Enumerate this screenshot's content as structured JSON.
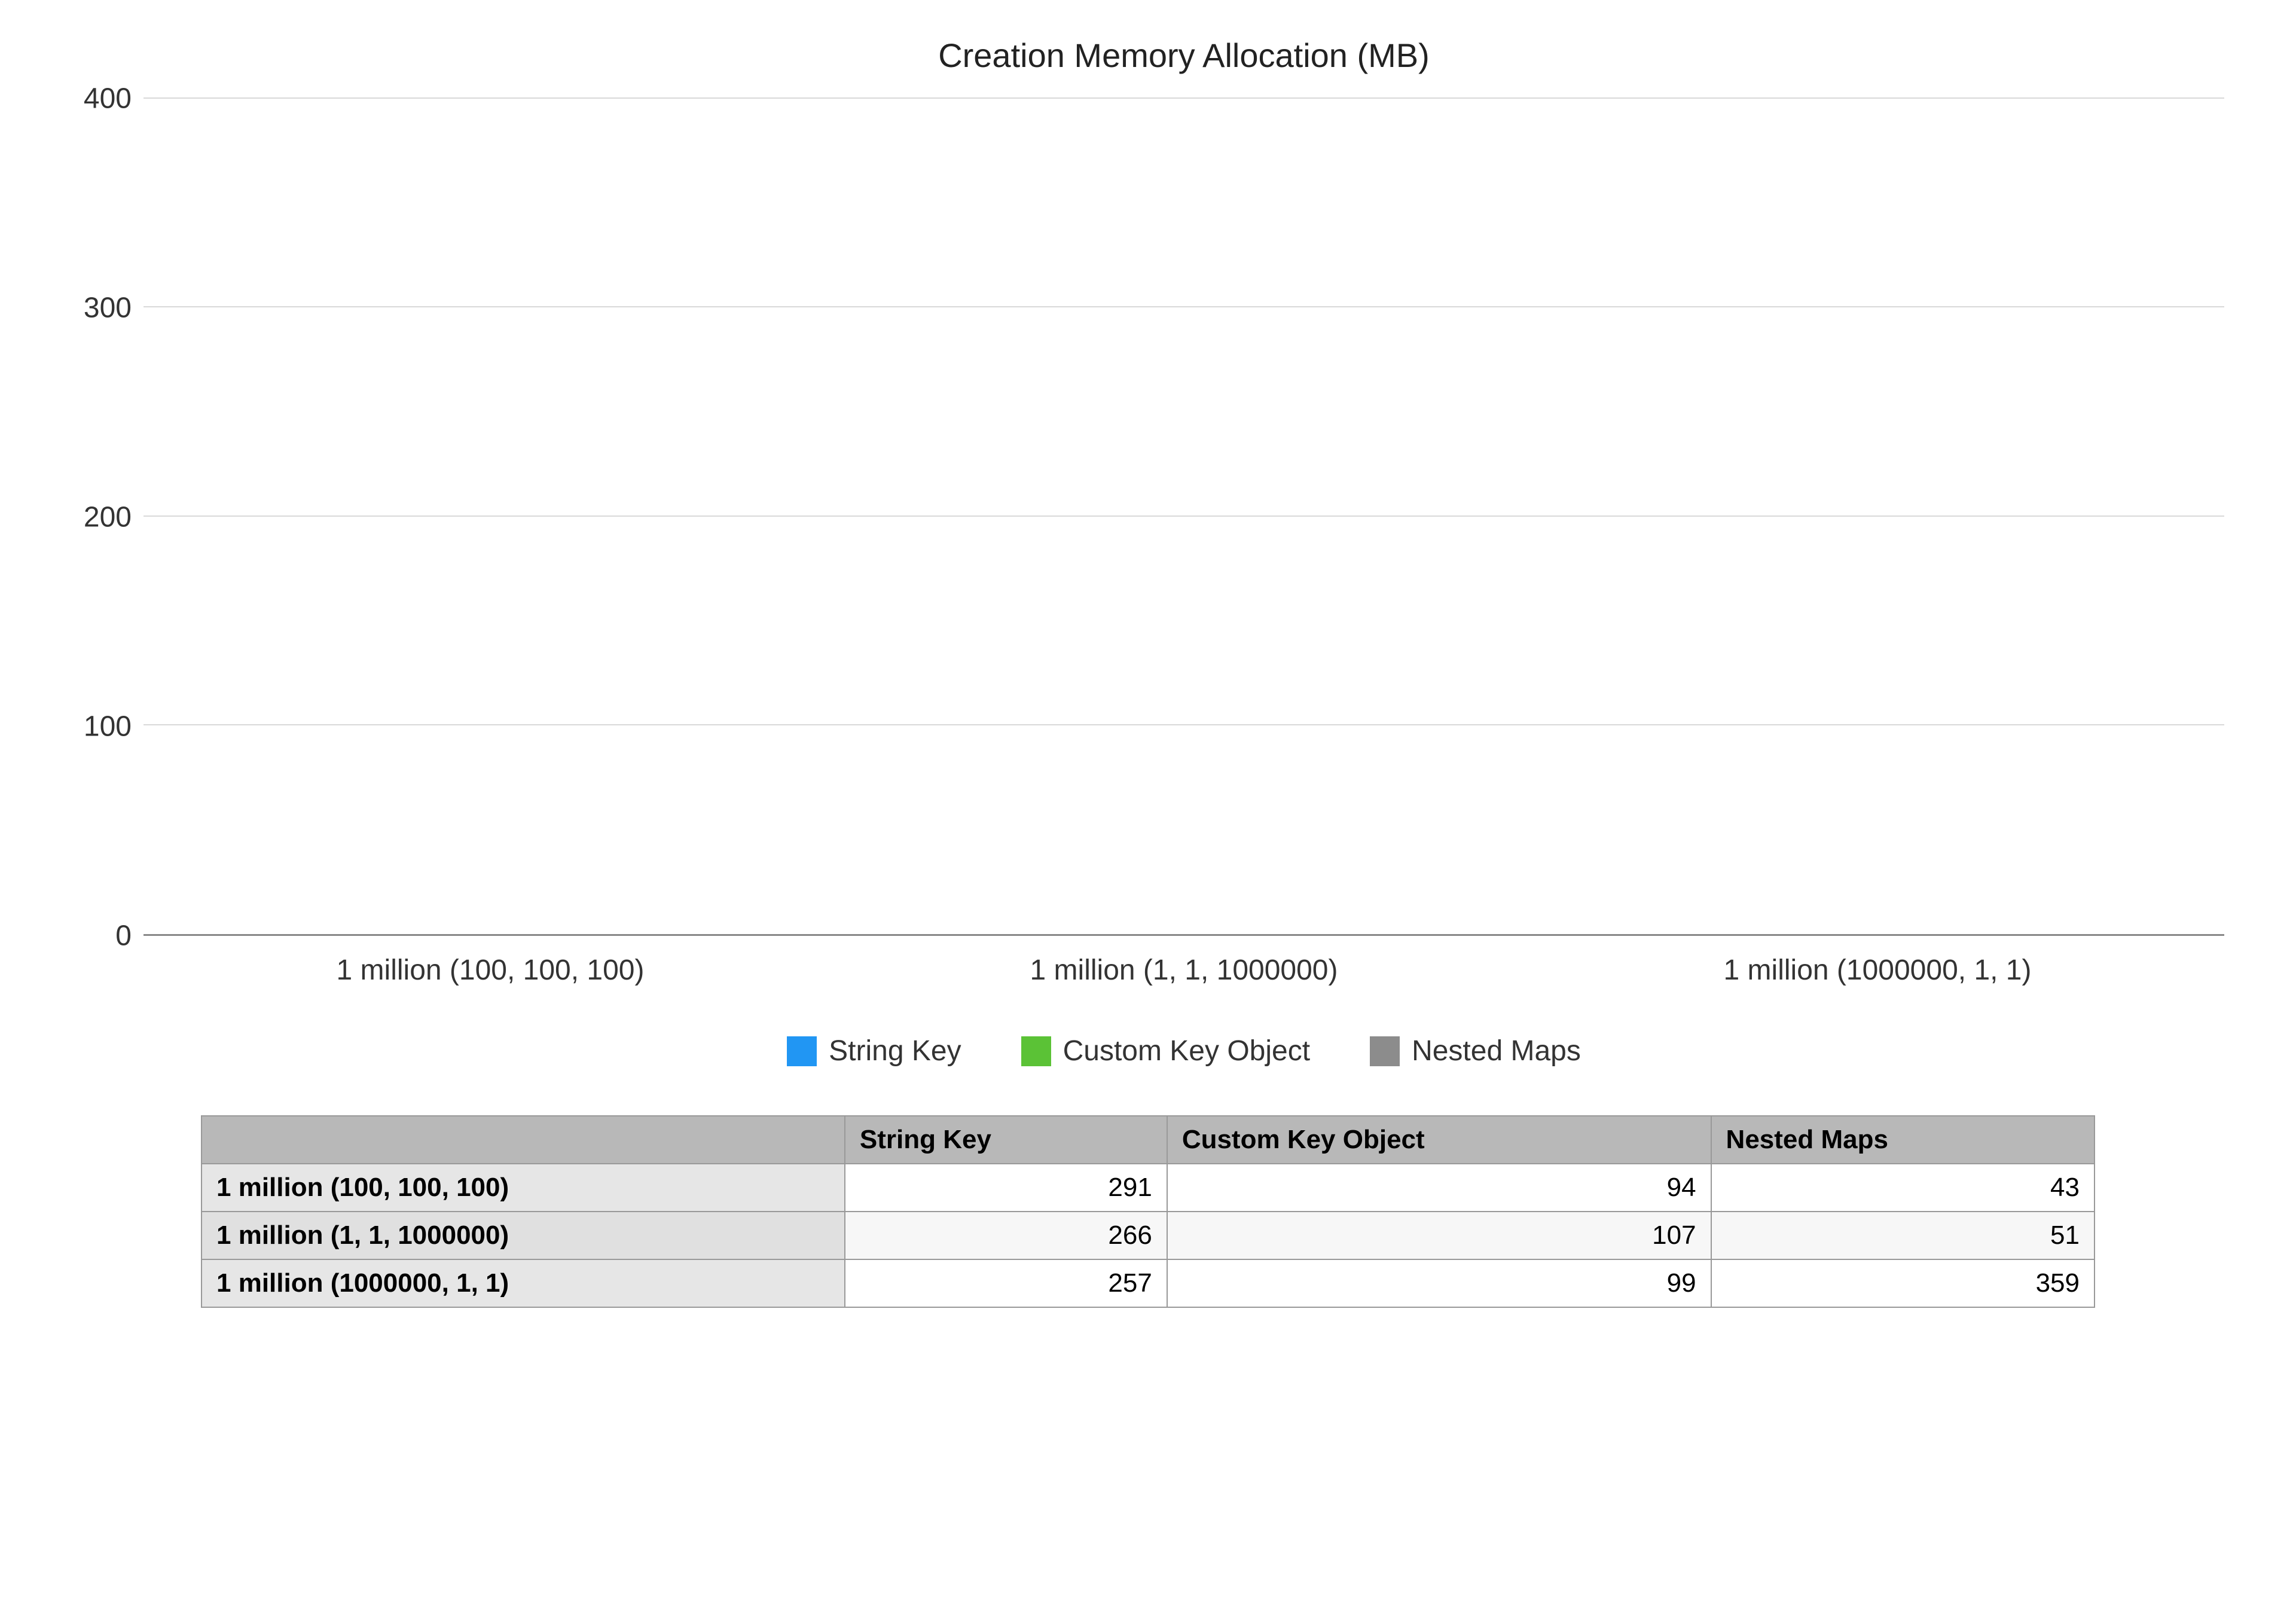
{
  "chart_data": {
    "type": "bar",
    "title": "Creation Memory Allocation (MB)",
    "xlabel": "",
    "ylabel": "",
    "ylim": [
      0,
      400
    ],
    "yticks": [
      0,
      100,
      200,
      300,
      400
    ],
    "categories": [
      "1 million (100, 100, 100)",
      "1 million (1, 1, 1000000)",
      "1 million (1000000, 1, 1)"
    ],
    "series": [
      {
        "name": "String Key",
        "values": [
          291,
          266,
          257
        ],
        "color": "#2196f3"
      },
      {
        "name": "Custom Key Object",
        "values": [
          94,
          107,
          99
        ],
        "color": "#5bc236"
      },
      {
        "name": "Nested Maps",
        "values": [
          43,
          51,
          359
        ],
        "color": "#8c8c8c"
      }
    ]
  },
  "table": {
    "corner": "",
    "columns": [
      "String Key",
      "Custom Key Object",
      "Nested Maps"
    ],
    "rows": [
      {
        "label": "1 million (100, 100, 100)",
        "cells": [
          291,
          94,
          43
        ]
      },
      {
        "label": "1 million (1, 1, 1000000)",
        "cells": [
          266,
          107,
          51
        ]
      },
      {
        "label": "1 million (1000000, 1, 1)",
        "cells": [
          257,
          99,
          359
        ]
      }
    ]
  }
}
